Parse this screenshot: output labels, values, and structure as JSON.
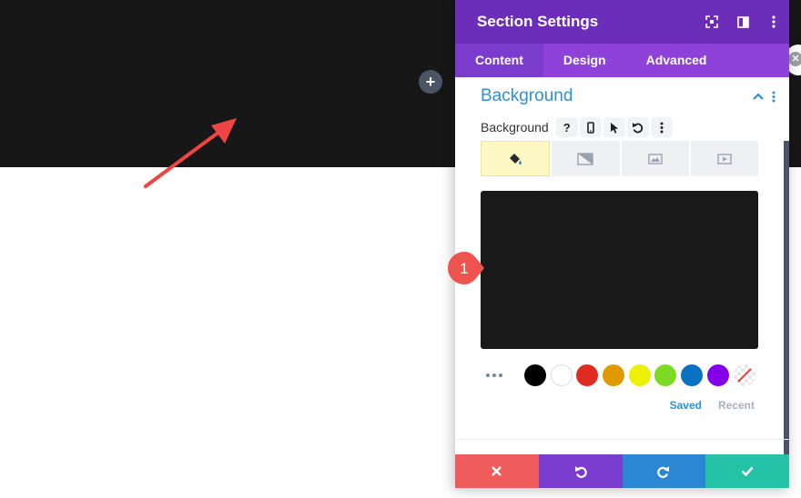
{
  "modal": {
    "title": "Section Settings",
    "tabs": [
      {
        "label": "Content",
        "active": true
      },
      {
        "label": "Design",
        "active": false
      },
      {
        "label": "Advanced",
        "active": false
      }
    ]
  },
  "group": {
    "title": "Background"
  },
  "background_option": {
    "label": "Background",
    "help_glyph": "?"
  },
  "background_types": [
    {
      "name": "color",
      "icon": "paint-bucket-icon",
      "active": true
    },
    {
      "name": "gradient",
      "icon": "gradient-icon",
      "active": false
    },
    {
      "name": "image",
      "icon": "image-icon",
      "active": false
    },
    {
      "name": "video",
      "icon": "video-icon",
      "active": false
    }
  ],
  "preview": {
    "color": "#191919"
  },
  "swatches": [
    "#000000",
    "#ffffff",
    "#e02b20",
    "#e09900",
    "#edf000",
    "#7cda24",
    "#0c71c3",
    "#8300e9"
  ],
  "palette_tabs": {
    "saved": "Saved",
    "recent": "Recent"
  },
  "callout": {
    "number": "1",
    "color": "#ef5350"
  },
  "colors": {
    "header": "#6c2eb9",
    "tabs_bar": "#8e42d9",
    "accent": "#2e8fd6",
    "cancel": "#ef5c5c",
    "undo": "#7a3ccf",
    "redo": "#2b87d3",
    "save": "#24c2a6"
  }
}
